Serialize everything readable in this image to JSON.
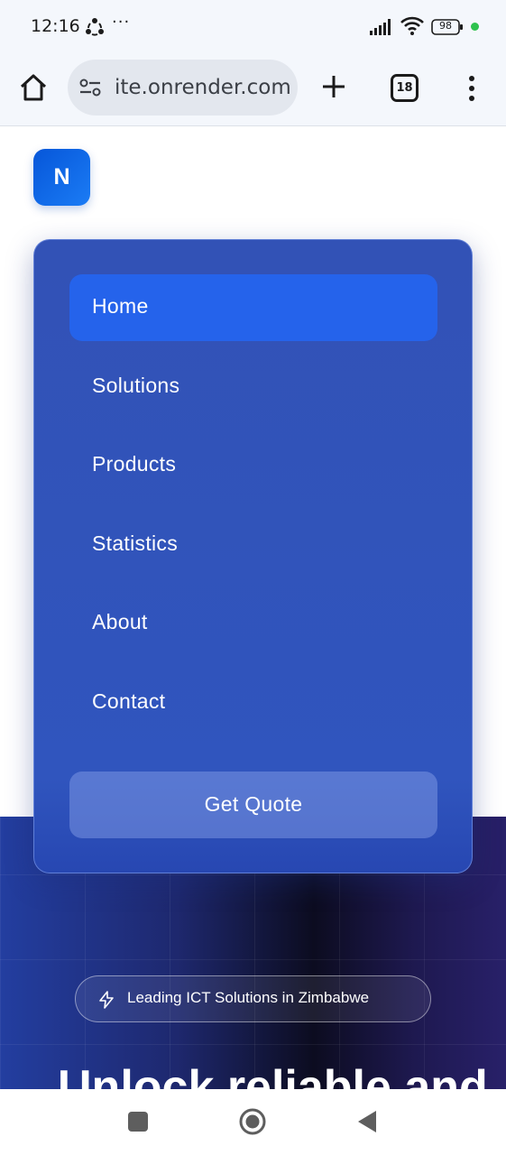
{
  "status_bar": {
    "time": "12:16",
    "more": "···",
    "battery": "98",
    "dot_color": "#2ec24e",
    "icons": [
      "sync-icon",
      "signal-icon",
      "wifi-icon",
      "battery-icon"
    ]
  },
  "browser": {
    "url": "ite.onrender.com",
    "tab_count": "18",
    "icons": [
      "home-icon",
      "site-settings-icon",
      "new-tab-icon",
      "tabs-icon",
      "menu-icon"
    ]
  },
  "site": {
    "logo_letter": "N",
    "brand_color": "#2563eb"
  },
  "menu": {
    "items": [
      {
        "label": "Home",
        "active": true
      },
      {
        "label": "Solutions",
        "active": false
      },
      {
        "label": "Products",
        "active": false
      },
      {
        "label": "Statistics",
        "active": false
      },
      {
        "label": "About",
        "active": false
      },
      {
        "label": "Contact",
        "active": false
      }
    ],
    "cta_label": "Get Quote"
  },
  "hero": {
    "badge_text": "Leading ICT Solutions in Zimbabwe",
    "heading": "Unlock reliable and"
  },
  "nav_bar": {
    "icons": [
      "recents-icon",
      "home-circle-icon",
      "back-icon"
    ]
  }
}
